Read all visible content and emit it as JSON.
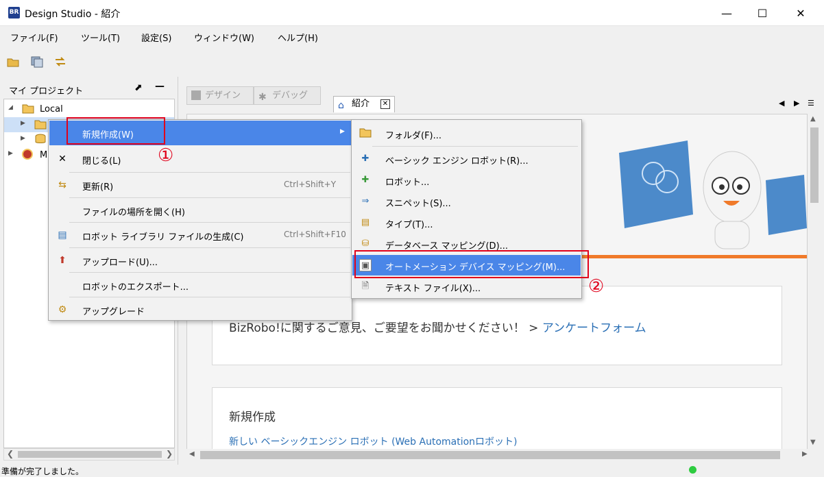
{
  "window": {
    "app_icon": "BR",
    "title": "Design Studio - 紹介",
    "minimize": "—",
    "maximize": "☐",
    "close": "✕"
  },
  "menubar": [
    "ファイル(F)",
    "ツール(T)",
    "設定(S)",
    "ウィンドウ(W)",
    "ヘルプ(H)"
  ],
  "toolbar": {
    "icons": [
      "open-folder-icon",
      "save-all-icon",
      "refresh-icon"
    ]
  },
  "left_panel": {
    "title": "マイ プロジェクト",
    "tree": [
      {
        "label": "Local",
        "icon": "folder-icon"
      },
      {
        "label": "",
        "icon": "folder-icon"
      },
      {
        "label": "",
        "icon": "database-icon"
      },
      {
        "label": "M",
        "icon": "management-icon"
      }
    ]
  },
  "right_panel": {
    "modes": [
      "デザイン",
      "デバッグ"
    ],
    "tab": "紹介",
    "feedback_text": "BizRobo!に関するご意見、ご要望をお聞かせください！ > ",
    "feedback_link": "アンケートフォーム",
    "new_heading": "新規作成",
    "new_link": "新しい ベーシックエンジン ロボット (Web Automationロボット)"
  },
  "context_menu": [
    {
      "label": "新規作成(W)",
      "shortcut": "",
      "icon": "",
      "submenu": "▶"
    },
    {
      "label": "閉じる(L)",
      "shortcut": "",
      "icon": "close-icon"
    },
    {
      "label": "更新(R)",
      "shortcut": "Ctrl+Shift+Y",
      "icon": "refresh-icon"
    },
    {
      "label": "ファイルの場所を開く(H)",
      "shortcut": "",
      "icon": ""
    },
    {
      "label": "ロボット ライブラリ ファイルの生成(C)",
      "shortcut": "Ctrl+Shift+F10",
      "icon": "library-icon"
    },
    {
      "label": "アップロード(U)...",
      "shortcut": "",
      "icon": "upload-icon"
    },
    {
      "label": "ロボットのエクスポート...",
      "shortcut": "",
      "icon": ""
    },
    {
      "label": "アップグレード",
      "shortcut": "",
      "icon": "upgrade-icon"
    }
  ],
  "submenu": [
    {
      "label": "フォルダ(F)...",
      "icon": "folder-icon"
    },
    {
      "label": "ベーシック エンジン ロボット(R)...",
      "icon": "robot-icon"
    },
    {
      "label": "ロボット...",
      "icon": "robot-green-icon"
    },
    {
      "label": "スニペット(S)...",
      "icon": "snippet-icon"
    },
    {
      "label": "タイプ(T)...",
      "icon": "type-icon"
    },
    {
      "label": "データベース マッピング(D)...",
      "icon": "database-icon"
    },
    {
      "label": "オートメーション デバイス マッピング(M)...",
      "icon": "device-mapping-icon"
    },
    {
      "label": "テキスト ファイル(X)...",
      "icon": "text-file-icon"
    }
  ],
  "annotations": [
    "①",
    "②"
  ],
  "status": {
    "text": "準備が完了しました。"
  },
  "colors": {
    "highlight": "#4a86e8",
    "annotation_red": "#e0001a",
    "accent_orange": "#f07a2a",
    "link": "#2a6fb5"
  }
}
